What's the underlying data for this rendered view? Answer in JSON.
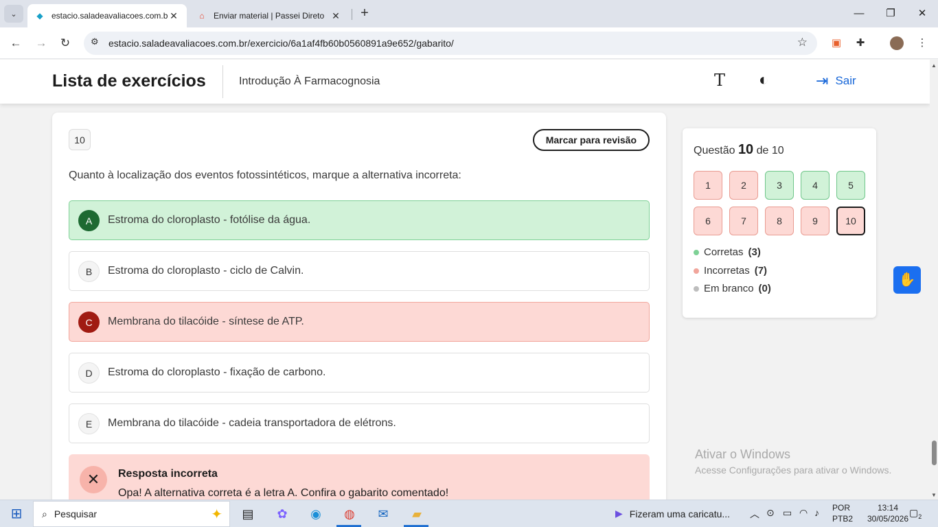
{
  "browser": {
    "tabs": [
      {
        "title": "estacio.saladeavaliacoes.com.br",
        "favicon": "diamond-icon",
        "active": true
      },
      {
        "title": "Enviar material | Passei Direto",
        "favicon": "passei-direto-icon",
        "active": false
      }
    ],
    "url": "estacio.saladeavaliacoes.com.br/exercicio/6a1af4fb60b0560891a9e652/gabarito/"
  },
  "header": {
    "title": "Lista de exercícios",
    "course": "Introdução À Farmacognosia",
    "font_icon": "T",
    "contrast_icon": "◐",
    "logout_label": "Sair"
  },
  "question": {
    "number": "10",
    "mark_label": "Marcar para revisão",
    "text": "Quanto à localização dos eventos fotossintéticos, marque a alternativa incorreta:",
    "options": [
      {
        "letter": "A",
        "text": "Estroma do cloroplasto - fotólise da água.",
        "state": "correct"
      },
      {
        "letter": "B",
        "text": "Estroma do cloroplasto - ciclo de Calvin.",
        "state": "neutral"
      },
      {
        "letter": "C",
        "text": "Membrana do tilacóide - síntese de ATP.",
        "state": "wrong"
      },
      {
        "letter": "D",
        "text": "Estroma do cloroplasto - fixação de carbono.",
        "state": "neutral"
      },
      {
        "letter": "E",
        "text": "Membrana do tilacóide - cadeia transportadora de elétrons.",
        "state": "neutral"
      }
    ],
    "feedback": {
      "title": "Resposta incorreta",
      "message": "Opa! A alternativa correta é a letra A. Confira o gabarito comentado!"
    }
  },
  "sidebar": {
    "label_prefix": "Questão",
    "current": "10",
    "label_suffix": "de 10",
    "numbers": [
      {
        "n": "1",
        "s": "w"
      },
      {
        "n": "2",
        "s": "w"
      },
      {
        "n": "3",
        "s": "c"
      },
      {
        "n": "4",
        "s": "c"
      },
      {
        "n": "5",
        "s": "c"
      },
      {
        "n": "6",
        "s": "w"
      },
      {
        "n": "7",
        "s": "w"
      },
      {
        "n": "8",
        "s": "w"
      },
      {
        "n": "9",
        "s": "w"
      },
      {
        "n": "10",
        "s": "w"
      }
    ],
    "legend": [
      {
        "label": "Corretas",
        "count": "(3)",
        "color": "#7ed196"
      },
      {
        "label": "Incorretas",
        "count": "(7)",
        "color": "#f1a59b"
      },
      {
        "label": "Em branco",
        "count": "(0)",
        "color": "#bdbdbd"
      }
    ]
  },
  "watermark": {
    "line1": "Ativar o Windows",
    "line2": "Acesse Configurações para ativar o Windows."
  },
  "taskbar": {
    "search_label": "Pesquisar",
    "news": "Fizeram uma caricatu...",
    "lang1": "POR",
    "lang2": "PTB2",
    "time": "13:14",
    "date": "30/05/2026",
    "notifications": "2"
  },
  "colors": {
    "accent": "#1565d8",
    "correct": "#d1f2d8",
    "wrong": "#fdd9d5"
  }
}
